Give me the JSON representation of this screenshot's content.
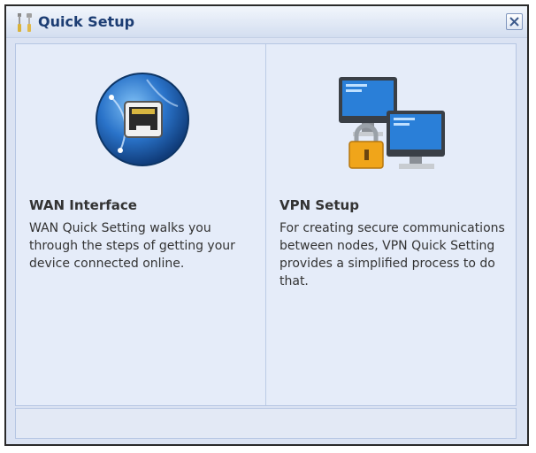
{
  "dialog": {
    "title": "Quick Setup",
    "title_icon": "tools-icon",
    "close_icon": "close-icon"
  },
  "options": [
    {
      "title": "WAN Interface",
      "description": "WAN Quick Setting walks you through the steps of getting your device connected online.",
      "icon": "network-globe-icon"
    },
    {
      "title": "VPN Setup",
      "description": "For creating secure communications between nodes, VPN Quick Setting provides a simplified process to do that.",
      "icon": "vpn-computers-lock-icon"
    }
  ]
}
